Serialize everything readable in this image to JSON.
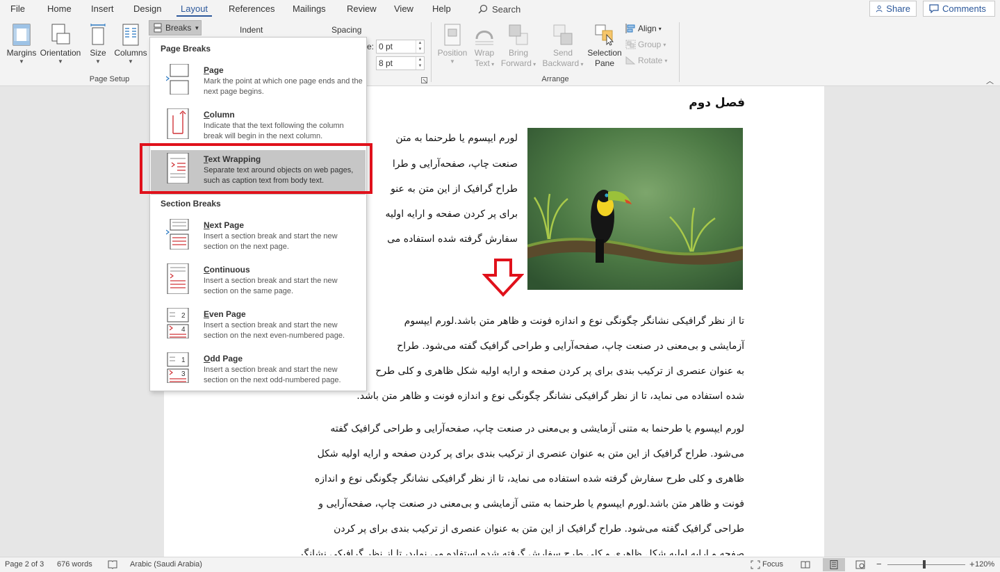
{
  "menu": {
    "tabs": [
      "File",
      "Home",
      "Insert",
      "Design",
      "Layout",
      "References",
      "Mailings",
      "Review",
      "View",
      "Help"
    ],
    "active_tab": "Layout",
    "search_label": "Search",
    "share_label": "Share",
    "comments_label": "Comments"
  },
  "ribbon": {
    "margins": "Margins",
    "orientation": "Orientation",
    "size": "Size",
    "columns": "Columns",
    "breaks": "Breaks",
    "page_setup_label": "Page Setup",
    "indent_label": "Indent",
    "spacing_label": "Spacing",
    "spacing_before_label": "e:",
    "spacing_before_value": "0 pt",
    "spacing_after_value": "8 pt",
    "position": "Position",
    "wrap_text_1": "Wrap",
    "wrap_text_2": "Text",
    "bring_forward_1": "Bring",
    "bring_forward_2": "Forward",
    "send_backward_1": "Send",
    "send_backward_2": "Backward",
    "selection_pane_1": "Selection",
    "selection_pane_2": "Pane",
    "align": "Align",
    "group": "Group",
    "rotate": "Rotate",
    "arrange_label": "Arrange"
  },
  "breaks_menu": {
    "page_breaks_header": "Page Breaks",
    "section_breaks_header": "Section Breaks",
    "items": [
      {
        "key": "P",
        "rest": "age",
        "desc": "Mark the point at which one page ends and the next page begins."
      },
      {
        "key": "C",
        "rest": "olumn",
        "desc": "Indicate that the text following the column break will begin in the next column."
      },
      {
        "key": "T",
        "rest": "ext Wrapping",
        "desc": "Separate text around objects on web pages, such as caption text from body text."
      },
      {
        "key": "N",
        "rest": "ext Page",
        "desc": "Insert a section break and start the new section on the next page."
      },
      {
        "key": "C",
        "rest": "ontinuous",
        "desc": "Insert a section break and start the new section on the same page."
      },
      {
        "key": "E",
        "rest": "ven Page",
        "desc": "Insert a section break and start the new section on the next even-numbered page."
      },
      {
        "key": "O",
        "rest": "dd Page",
        "desc": "Insert a section break and start the new section on the next odd-numbered page."
      }
    ],
    "even_page_num_top": "2",
    "even_page_num_bottom": "4",
    "odd_page_num_top": "1",
    "odd_page_num_bottom": "3"
  },
  "document": {
    "heading": "فصل دوم",
    "wrap_lines": [
      "لورم ایپسوم یا طرحنما به متن",
      "صنعت چاپ، صفحه‌آرایی و طرا",
      "طراح گرافیک از این متن به عنو",
      "برای پر کردن صفحه و ارایه اولیه",
      "سفارش گرفته شده استفاده می"
    ],
    "para1_lines": [
      "تا از نظر گرافیکی نشانگر چگونگی نوع و اندازه فونت و ظاهر متن باشد.لورم ایپسوم",
      "آزمایشی و بی‌معنی در صنعت چاپ، صفحه‌آرایی و طراحی گرافیک گفته می‌شود. طراح",
      "به عنوان عنصری از ترکیب بندی برای پر کردن صفحه و ارایه اولیه شکل ظاهری و کلی طرح",
      "شده استفاده می نماید، تا از نظر گرافیکی نشانگر چگونگی نوع و اندازه فونت و ظاهر متن باشد."
    ],
    "para2_lines": [
      "لورم ایپسوم یا طرحنما به متنی آزمایشی و بی‌معنی در صنعت چاپ، صفحه‌آرایی و طراحی گرافیک گفته",
      "می‌شود. طراح گرافیک از این متن به عنوان عنصری از ترکیب بندی برای پر کردن صفحه و ارایه اولیه شکل",
      "ظاهری و کلی طرح سفارش گرفته شده استفاده می نماید، تا از نظر گرافیکی نشانگر چگونگی نوع و اندازه",
      "فونت و ظاهر متن باشد.لورم ایپسوم یا طرحنما به متنی آزمایشی و بی‌معنی در صنعت چاپ، صفحه‌آرایی و",
      "طراحی گرافیک گفته می‌شود. طراح گرافیک از این متن به عنوان عنصری از ترکیب بندی برای پر کردن",
      "صفحه و ارایه اولیه شکل ظاهری و کلی طرح سفارش گرفته شده استفاده می نماید، تا از نظر گرافیکی نشانگر"
    ]
  },
  "status": {
    "page": "Page 2 of 3",
    "words": "676 words",
    "language": "Arabic (Saudi Arabia)",
    "focus": "Focus",
    "zoom_minus": "−",
    "zoom_plus": "+",
    "zoom": "120%"
  },
  "colors": {
    "accent": "#2b579a",
    "highlight_box": "#e0111b",
    "menu_highlight": "#c6c6c6",
    "icon_red": "#d13438"
  }
}
